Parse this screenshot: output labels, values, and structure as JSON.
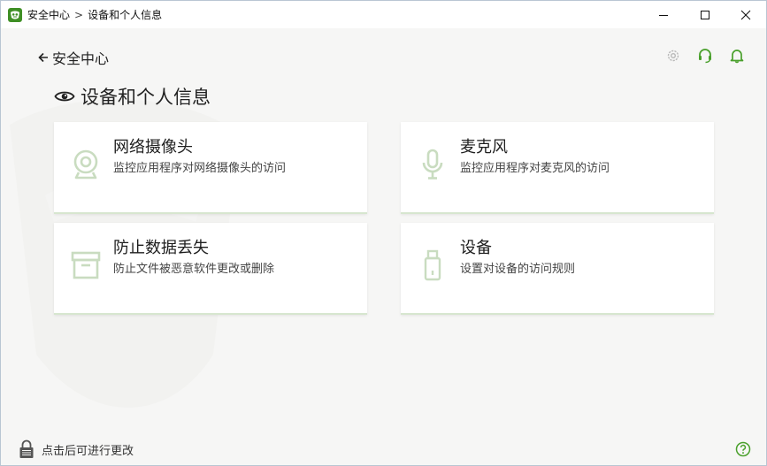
{
  "titlebar": {
    "app_name": "安全中心",
    "separator": ">",
    "current": "设备和个人信息"
  },
  "header": {
    "back_label": "安全中心",
    "page_title": "设备和个人信息"
  },
  "cards": [
    {
      "title": "网络摄像头",
      "description": "监控应用程序对网络摄像头的访问",
      "icon": "webcam-icon"
    },
    {
      "title": "麦克风",
      "description": "监控应用程序对麦克风的访问",
      "icon": "microphone-icon"
    },
    {
      "title": "防止数据丢失",
      "description": "防止文件被恶意软件更改或删除",
      "icon": "archive-box-icon"
    },
    {
      "title": "设备",
      "description": "设置对设备的访问规则",
      "icon": "usb-drive-icon"
    }
  ],
  "footer": {
    "lock_label": "点击后可进行更改"
  },
  "colors": {
    "accent_green": "#4aa02c",
    "card_icon": "#c9dcc0",
    "background": "#f6f6f5"
  }
}
